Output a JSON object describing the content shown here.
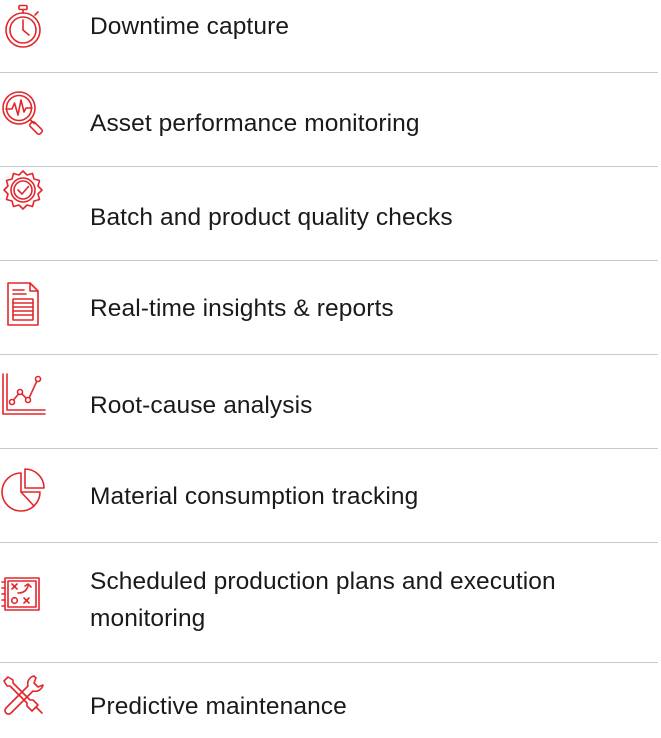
{
  "accent_color": "#e3262b",
  "text_color": "#1a1a1a",
  "divider_color": "#c9c9c9",
  "features": [
    {
      "icon": "stopwatch-icon",
      "label": "Downtime capture"
    },
    {
      "icon": "magnifier-heartbeat-icon",
      "label": "Asset performance monitoring"
    },
    {
      "icon": "quality-badge-check-icon",
      "label": "Batch and product quality checks"
    },
    {
      "icon": "report-document-icon",
      "label": "Real-time insights & reports"
    },
    {
      "icon": "line-graph-icon",
      "label": "Root-cause analysis"
    },
    {
      "icon": "pie-chart-icon",
      "label": "Material consumption tracking"
    },
    {
      "icon": "strategy-plan-icon",
      "label": "Scheduled production plans and execution monitoring"
    },
    {
      "icon": "tools-wrench-screwdriver-icon",
      "label": "Predictive maintenance"
    }
  ]
}
